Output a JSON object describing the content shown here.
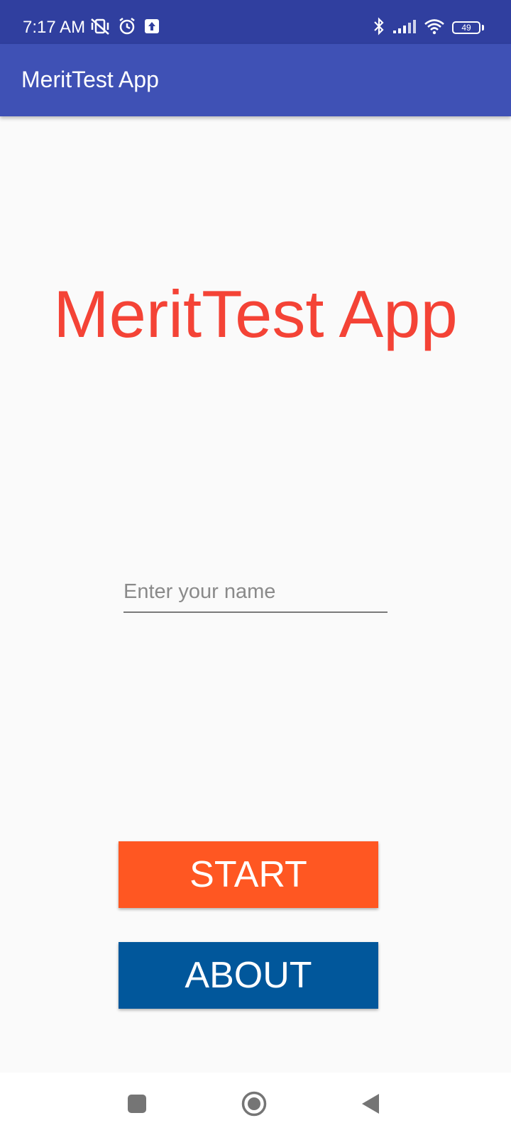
{
  "status_bar": {
    "time": "7:17 AM",
    "left_icons": [
      "vibrate-mute-icon",
      "alarm-icon",
      "upload-icon"
    ],
    "right_icons": [
      "bluetooth-icon",
      "signal-icon",
      "wifi-icon",
      "battery-icon"
    ],
    "battery_level": "49"
  },
  "app_bar": {
    "title": "MeritTest App"
  },
  "main": {
    "title": "MeritTest App",
    "name_input": {
      "placeholder": "Enter your name",
      "value": ""
    },
    "start_button": "START",
    "about_button": "ABOUT"
  },
  "nav_bar": {
    "buttons": [
      "recents-icon",
      "home-icon",
      "back-icon"
    ]
  },
  "colors": {
    "status_bar": "#303f9f",
    "app_bar": "#3f51b5",
    "title_text": "#f44336",
    "start_button": "#ff5722",
    "about_button": "#01579b",
    "background": "#fafafa"
  }
}
